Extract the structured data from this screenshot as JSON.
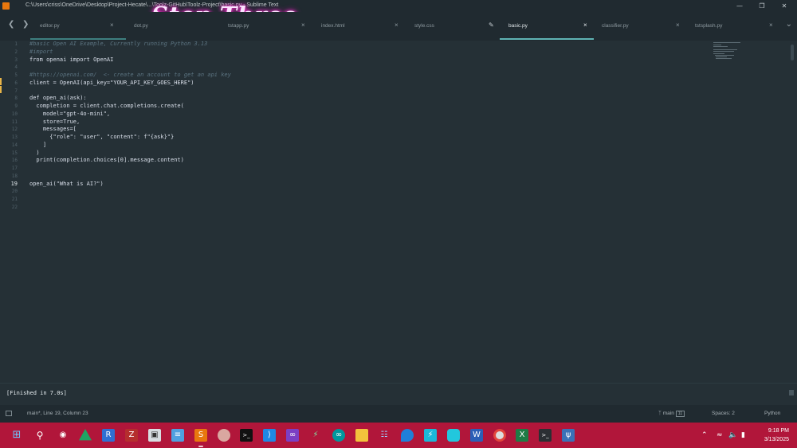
{
  "window": {
    "title": "C:\\Users\\criss\\OneDrive\\Desktop\\Project-Hecate\\...\\Toolz-GitHub\\Toolz-Project\\basic.py - Sublime Text",
    "overlay_title": "Step Three"
  },
  "tabs": [
    {
      "label": "editor.py",
      "active": false
    },
    {
      "label": "dot.py",
      "active": false
    },
    {
      "label": "tstapp.py",
      "active": false
    },
    {
      "label": "index.html",
      "active": false
    },
    {
      "label": "style.css",
      "active": false
    },
    {
      "label": "basic.py",
      "active": true
    },
    {
      "label": "classifier.py",
      "active": false
    },
    {
      "label": "tstsplash.py",
      "active": false
    }
  ],
  "editor": {
    "current_line": 19,
    "lines": [
      {
        "n": "1",
        "text": "#basic Open AI Example, Currently running Python 3.13"
      },
      {
        "n": "2",
        "text": "#import"
      },
      {
        "n": "3",
        "text": "from openai import OpenAI"
      },
      {
        "n": "4",
        "text": ""
      },
      {
        "n": "5",
        "text": "#https://openai.com/  <- create an account to get an api key"
      },
      {
        "n": "6",
        "text": "client = OpenAI(api_key=\"YOUR_API_KEY_GOES_HERE\")"
      },
      {
        "n": "7",
        "text": ""
      },
      {
        "n": "8",
        "text": "def open_ai(ask):"
      },
      {
        "n": "9",
        "text": "  completion = client.chat.completions.create("
      },
      {
        "n": "10",
        "text": "    model=\"gpt-4o-mini\","
      },
      {
        "n": "11",
        "text": "    store=True,"
      },
      {
        "n": "12",
        "text": "    messages=["
      },
      {
        "n": "13",
        "text": "      {\"role\": \"user\", \"content\": f\"{ask}\"}"
      },
      {
        "n": "14",
        "text": "    ]"
      },
      {
        "n": "15",
        "text": "  )"
      },
      {
        "n": "16",
        "text": "  print(completion.choices[0].message.content)"
      },
      {
        "n": "17",
        "text": ""
      },
      {
        "n": "18",
        "text": ""
      },
      {
        "n": "19",
        "text": "open_ai(\"What is AI?\")"
      },
      {
        "n": "20",
        "text": ""
      },
      {
        "n": "21",
        "text": ""
      },
      {
        "n": "22",
        "text": ""
      }
    ]
  },
  "output": {
    "text": "[Finished in 7.0s]"
  },
  "statusbar": {
    "position": "main*, Line 19, Column 23",
    "branch": "main",
    "branch_badge": "11",
    "indent": "Spaces: 2",
    "syntax": "Python"
  },
  "taskbar": {
    "time": "9:18 PM",
    "date": "3/13/2025",
    "icons": [
      "windows-start-icon",
      "search-icon",
      "copilot-icon",
      "google-drive-icon",
      "reader-icon",
      "filezilla-icon",
      "remote-desktop-icon",
      "notepad-icon",
      "sublime-text-icon",
      "contact-icon",
      "terminal-icon",
      "vscode-icon",
      "visual-studio-icon",
      "sourcetree-icon",
      "arduino-icon",
      "file-explorer-icon",
      "network-icon",
      "edge-icon",
      "electron-icon",
      "app-icon",
      "word-icon",
      "chrome-icon",
      "excel-icon",
      "command-prompt-icon",
      "python-icon"
    ]
  },
  "colors": {
    "background": "#253036",
    "accent": "#5fb3b3",
    "taskbar": "#b1163a",
    "comment": "#5b7380",
    "keyword": "#c594c5",
    "string": "#99c794",
    "function": "#6699cc"
  }
}
